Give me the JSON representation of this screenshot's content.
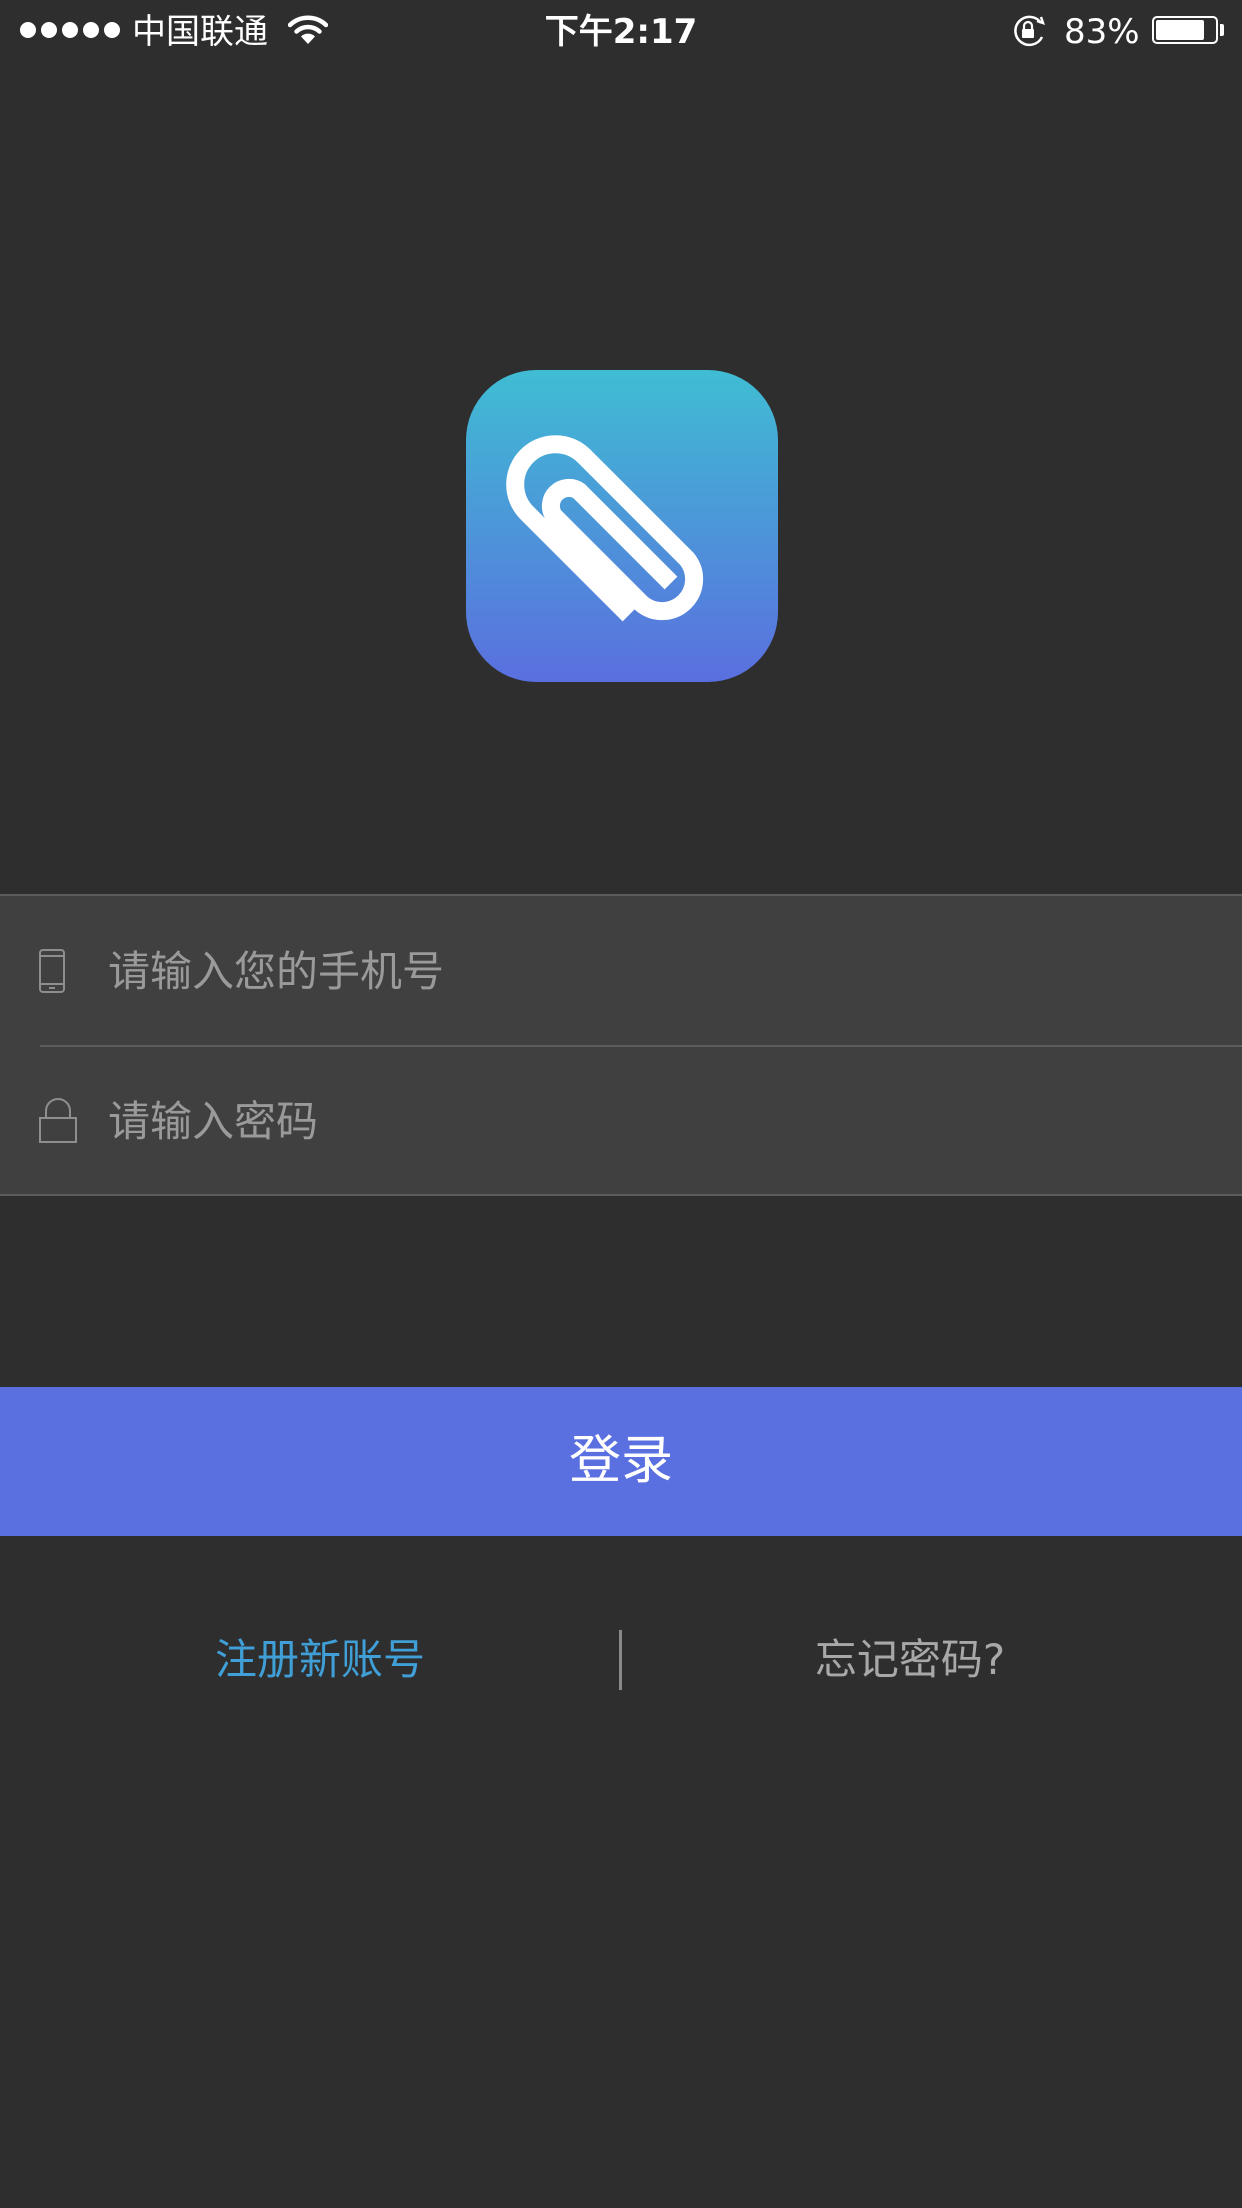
{
  "status_bar": {
    "carrier": "中国联通",
    "time": "下午2:17",
    "battery_percent": "83%",
    "battery_level": 0.83,
    "signal_bars": 5,
    "icons": [
      "signal-dots-icon",
      "wifi-icon",
      "rotation-lock-icon",
      "battery-icon"
    ]
  },
  "logo": {
    "icon": "paperclip-icon",
    "gradient_top": "#3fbdd3",
    "gradient_bottom": "#5a6fdf"
  },
  "form": {
    "phone": {
      "icon": "phone-icon",
      "placeholder": "请输入您的手机号",
      "value": ""
    },
    "password": {
      "icon": "lock-icon",
      "placeholder": "请输入密码",
      "value": ""
    }
  },
  "login_button": {
    "label": "登录",
    "color": "#5b70e0"
  },
  "links": {
    "register": "注册新账号",
    "forgot_password": "忘记密码?"
  },
  "colors": {
    "background": "#2e2e2f",
    "form_background": "#404041",
    "register_link": "#3f9fd6",
    "forgot_link": "#a8a8a9"
  }
}
